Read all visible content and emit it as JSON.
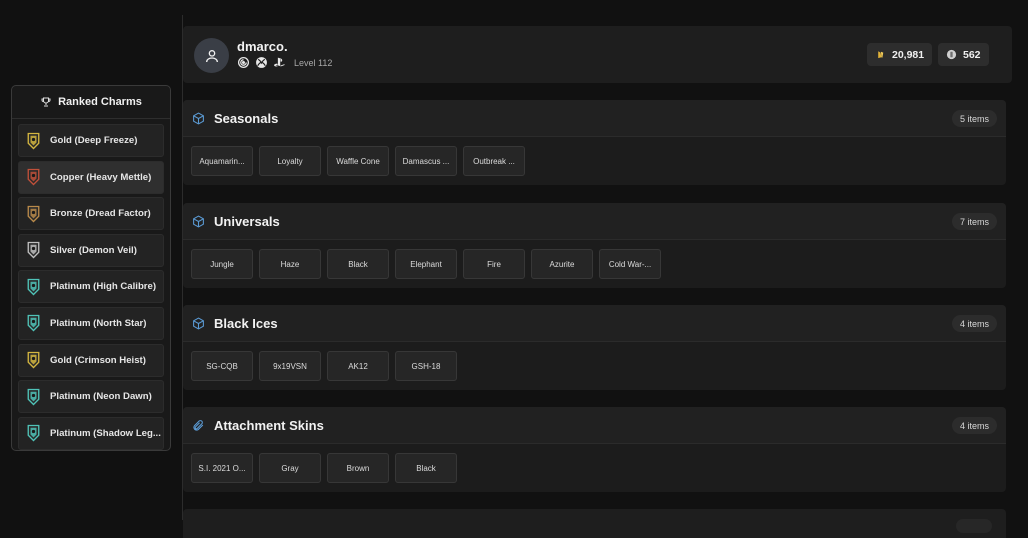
{
  "sidebar": {
    "title": "Ranked Charms",
    "items": [
      {
        "label": "Gold (Deep Freeze)",
        "color": "#d4b640"
      },
      {
        "label": "Copper (Heavy Mettle)",
        "color": "#c0503a"
      },
      {
        "label": "Bronze (Dread Factor)",
        "color": "#b98a4a"
      },
      {
        "label": "Silver (Demon Veil)",
        "color": "#bfbfbf"
      },
      {
        "label": "Platinum (High Calibre)",
        "color": "#4fc3b8"
      },
      {
        "label": "Platinum (North Star)",
        "color": "#4fc3b8"
      },
      {
        "label": "Gold (Crimson Heist)",
        "color": "#d4b640"
      },
      {
        "label": "Platinum (Neon Dawn)",
        "color": "#4fc3b8"
      },
      {
        "label": "Platinum (Shadow Leg...",
        "color": "#4fc3b8"
      }
    ]
  },
  "profile": {
    "username": "dmarco.",
    "level": "Level 112",
    "credits": "20,981",
    "renown": "562",
    "platform_icons": [
      "ubisoft-icon",
      "xbox-icon",
      "playstation-icon"
    ]
  },
  "sections": [
    {
      "title": "Seasonals",
      "count": "5 items",
      "icon": "cube-icon",
      "items": [
        "Aquamarin...",
        "Loyalty",
        "Waffle Cone",
        "Damascus ...",
        "Outbreak ..."
      ]
    },
    {
      "title": "Universals",
      "count": "7 items",
      "icon": "cube-icon",
      "items": [
        "Jungle",
        "Haze",
        "Black",
        "Elephant",
        "Fire",
        "Azurite",
        "Cold War-..."
      ]
    },
    {
      "title": "Black Ices",
      "count": "4 items",
      "icon": "cube-icon",
      "items": [
        "SG-CQB",
        "9x19VSN",
        "AK12",
        "GSH-18"
      ]
    },
    {
      "title": "Attachment Skins",
      "count": "4 items",
      "icon": "paperclip-icon",
      "items": [
        "S.I. 2021 O...",
        "Gray",
        "Brown",
        "Black"
      ]
    }
  ],
  "colors": {
    "accent_blue": "#5b9bd5",
    "background": "#111111"
  }
}
